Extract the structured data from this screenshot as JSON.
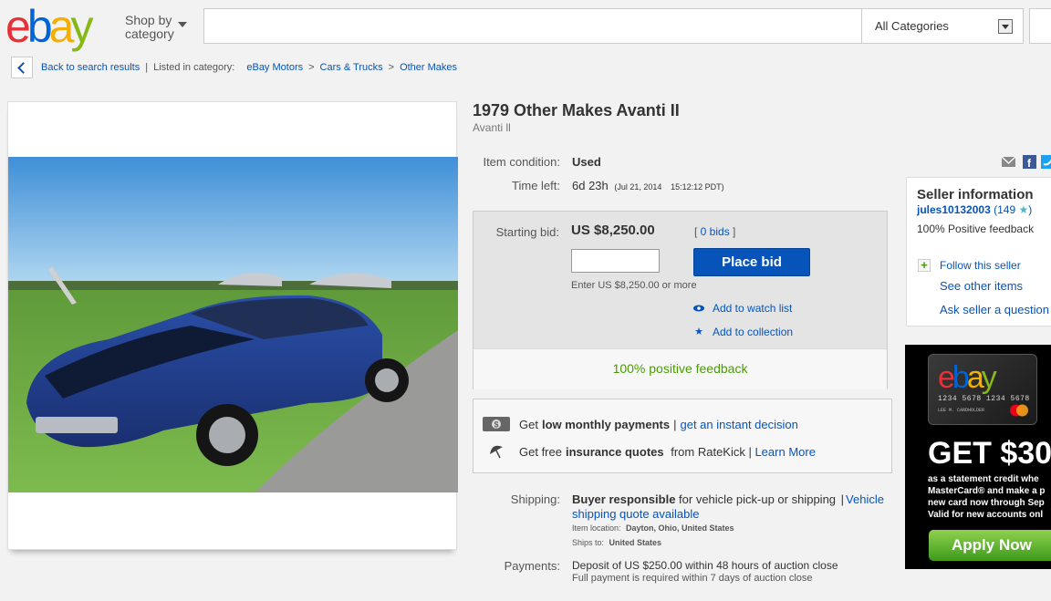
{
  "header": {
    "logo_letters": [
      {
        "char": "e",
        "color": "#e53238"
      },
      {
        "char": "b",
        "color": "#0064d2"
      },
      {
        "char": "a",
        "color": "#f5af02"
      },
      {
        "char": "y",
        "color": "#86b817"
      }
    ],
    "shop_by_line1": "Shop by",
    "shop_by_line2": "category",
    "search_placeholder": "",
    "category_select": "All Categories"
  },
  "breadcrumb": {
    "back_label": "Back to search results",
    "listed_in": "Listed in category:",
    "items": [
      "eBay Motors",
      "Cars & Trucks",
      "Other Makes"
    ]
  },
  "item": {
    "title": "1979 Other Makes Avanti II",
    "subtitle": "Avanti ll",
    "condition_label": "Item condition:",
    "condition_value": "Used",
    "time_left_label": "Time left:",
    "time_left_value": "6d 23h",
    "time_left_date": "(Jul 21, 2014",
    "time_left_time": "15:12:12 PDT)"
  },
  "bid": {
    "label": "Starting bid:",
    "amount": "US $8,250.00",
    "bids": "[ 0 bids ]",
    "bids_link": "0 bids",
    "place_bid": "Place bid",
    "enter_hint": "Enter US $8,250.00 or more",
    "watch": "Add to watch list",
    "collection": "Add to collection",
    "positive": "100% positive feedback"
  },
  "payments_box": {
    "line1_pre": "Get ",
    "line1_bold": "low monthly payments",
    "line1_sep": " | ",
    "line1_link": "get an instant decision",
    "line2_pre": "Get free ",
    "line2_bold": "insurance quotes",
    "line2_mid": " from RateKick | ",
    "line2_link": "Learn More"
  },
  "shipping": {
    "label": "Shipping:",
    "bold": "Buyer responsible",
    "text": " for vehicle pick-up or shipping",
    "sep": " | ",
    "link1": "Vehicle",
    "link2": "shipping quote available",
    "location_label": "Item location:",
    "location": "Dayton, Ohio, United States",
    "ships_label": "Ships to:",
    "ships_to": "United States"
  },
  "payments": {
    "label": "Payments:",
    "line1": "Deposit of US $250.00 within 48 hours of auction close",
    "line2": "Full payment is required within 7 days of auction close"
  },
  "seller": {
    "title": "Seller information",
    "name": "jules10132003",
    "score": "(149",
    "score_close": ")",
    "feedback": "100% Positive feedback",
    "follow": "Follow this seller",
    "other_items": "See other items",
    "ask": "Ask seller a question"
  },
  "ad": {
    "card_logo": "ebay",
    "card_number": "1234 5678 1234 5678",
    "card_holder": "LEE M. CARDHOLDER",
    "headline": "GET $30",
    "lines": [
      "as a statement credit  whe",
      "MasterCard® and make a p",
      "new card now through Sep",
      "Valid for new accounts onl"
    ],
    "apply": "Apply Now"
  },
  "colors": {
    "link": "#0654ba",
    "place_bid": "#0654ba",
    "positive_green": "#4c9a06"
  }
}
